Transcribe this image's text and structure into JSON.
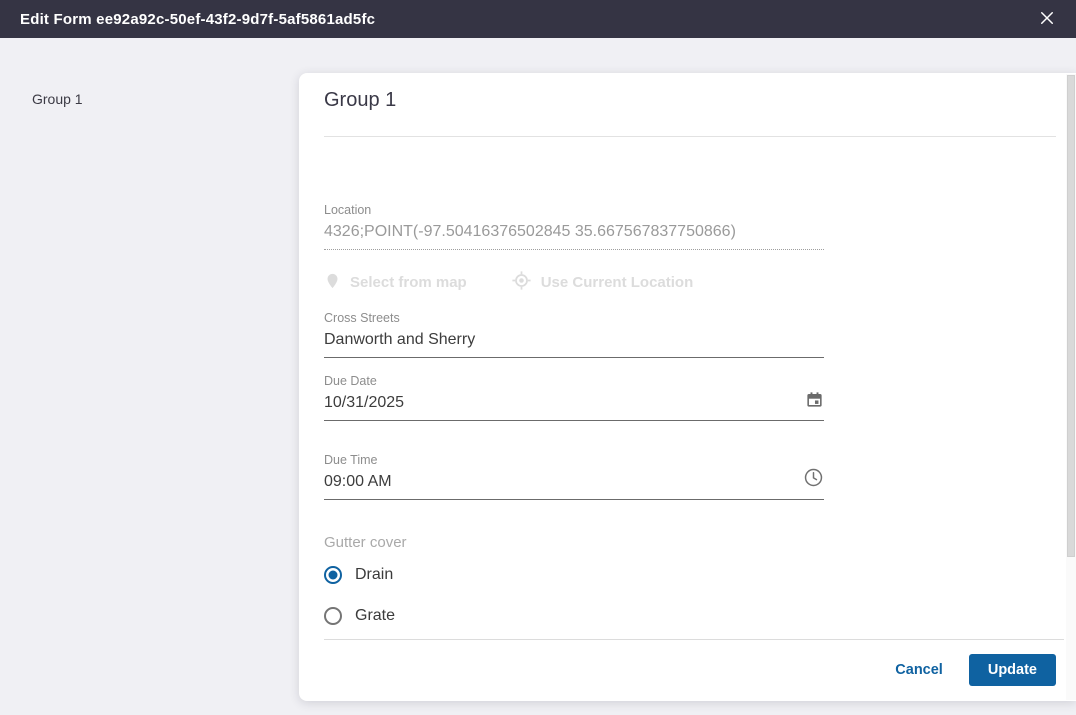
{
  "header": {
    "title": "Edit Form ee92a92c-50ef-43f2-9d7f-5af5861ad5fc"
  },
  "sidebar": {
    "items": [
      {
        "label": "Group 1"
      }
    ]
  },
  "panel": {
    "title": "Group 1",
    "location": {
      "label": "Location",
      "value": "4326;POINT(-97.50416376502845 35.667567837750866)",
      "disabled": true
    },
    "map_actions": {
      "select_from_map": "Select from map",
      "use_current_location": "Use Current Location",
      "disabled": true
    },
    "cross_streets": {
      "label": "Cross Streets",
      "value": "Danworth and Sherry"
    },
    "due_date": {
      "label": "Due Date",
      "value": "10/31/2025"
    },
    "due_time": {
      "label": "Due Time",
      "value": "09:00 AM"
    },
    "gutter_cover": {
      "label": "Gutter cover",
      "options": [
        {
          "label": "Drain",
          "selected": true
        },
        {
          "label": "Grate",
          "selected": false
        }
      ]
    },
    "footer": {
      "cancel": "Cancel",
      "update": "Update"
    }
  },
  "icons": {
    "close": "close-x",
    "select_from_map": "location-pin",
    "use_current_location": "crosshair-target",
    "due_date": "calendar",
    "due_time": "clock"
  },
  "colors": {
    "header_bg": "#353444",
    "body_bg": "#f0f0f4",
    "panel_bg": "#ffffff",
    "accent_blue": "#0f62a1",
    "disabled_action": "#dcdcdc",
    "field_underline": "#6b6b6b"
  }
}
